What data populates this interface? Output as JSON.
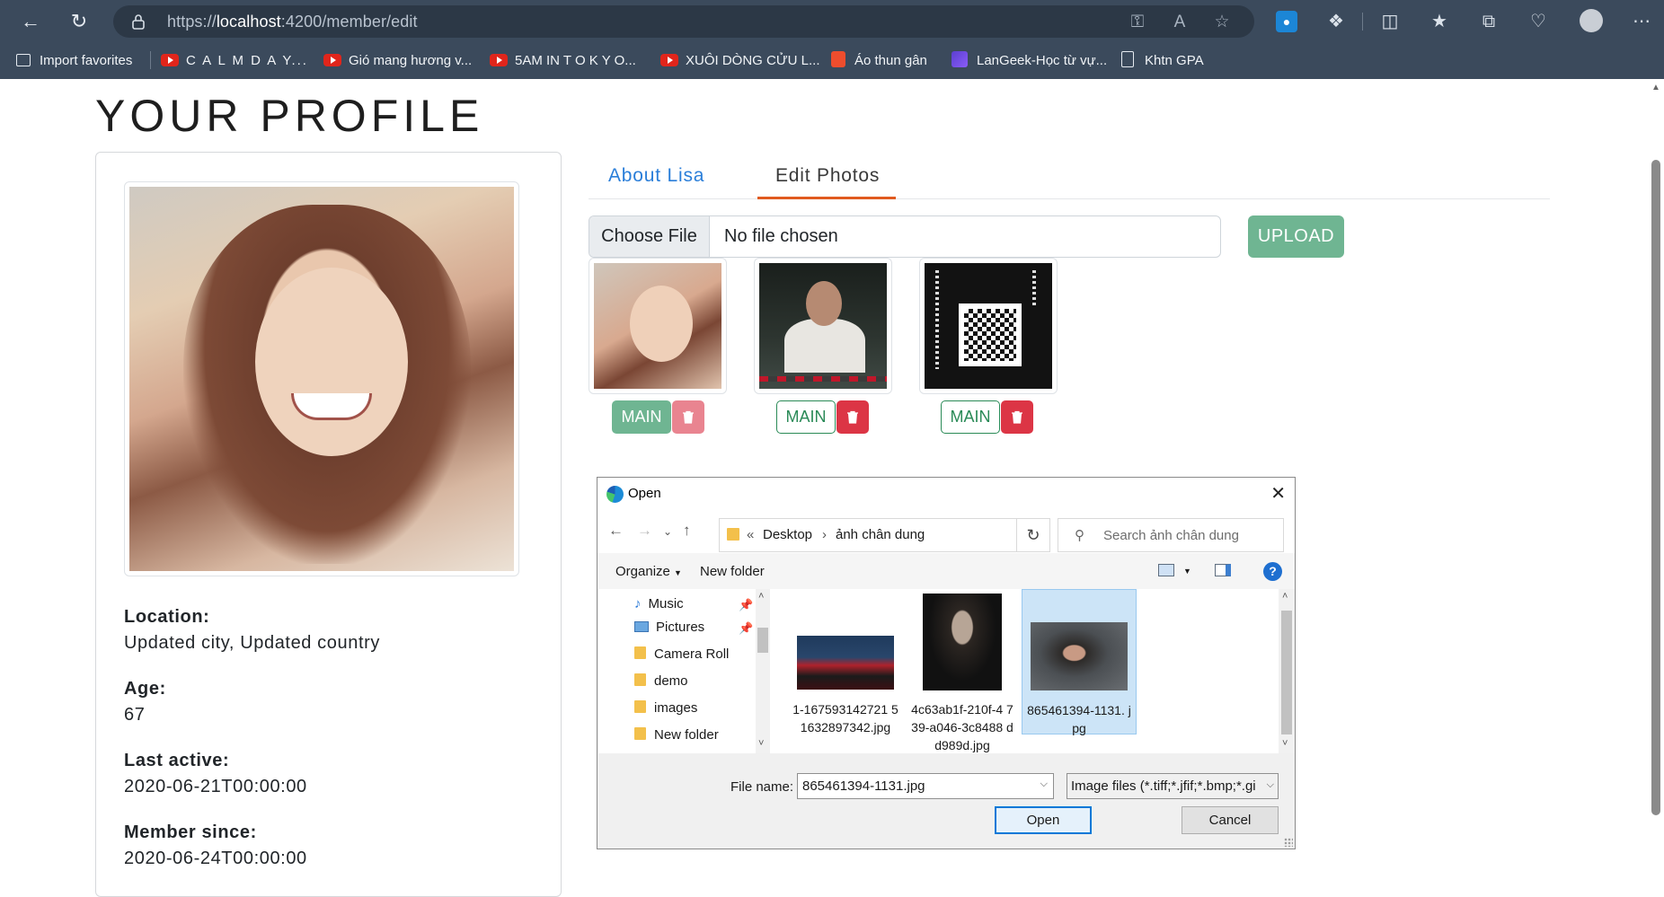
{
  "browser": {
    "url_prefix": "https://",
    "url_host": "localhost",
    "url_rest": ":4200/member/edit",
    "bookmarks": [
      {
        "label": "Import favorites",
        "icon": "import-icon"
      },
      {
        "label": "C A L M   D A Y...",
        "icon": "youtube-icon"
      },
      {
        "label": "Gió mang hương v...",
        "icon": "youtube-icon"
      },
      {
        "label": "5AM IN  T O K Y O...",
        "icon": "youtube-icon"
      },
      {
        "label": "XUÔI DÒNG CỬU L...",
        "icon": "youtube-icon"
      },
      {
        "label": "Áo thun gân",
        "icon": "shopee-icon"
      },
      {
        "label": "LanGeek-Học từ vự...",
        "icon": "langeek-icon"
      },
      {
        "label": "Khtn GPA",
        "icon": "document-icon"
      }
    ]
  },
  "page": {
    "title": "YOUR PROFILE"
  },
  "profile": {
    "location_label": "Location:",
    "location_value": "Updated city, Updated country",
    "age_label": "Age:",
    "age_value": "67",
    "last_active_label": "Last active:",
    "last_active_value": "2020-06-21T00:00:00",
    "member_since_label": "Member since:",
    "member_since_value": "2020-06-24T00:00:00"
  },
  "tabs": [
    {
      "label": "About Lisa",
      "active": false
    },
    {
      "label": "Edit Photos",
      "active": true
    }
  ],
  "upload": {
    "choose_label": "Choose File",
    "no_file_label": "No file chosen",
    "upload_label": "UPLOAD"
  },
  "photos": [
    {
      "main_label": "MAIN",
      "is_main": true
    },
    {
      "main_label": "MAIN",
      "is_main": false
    },
    {
      "main_label": "MAIN",
      "is_main": false
    }
  ],
  "dialog": {
    "title": "Open",
    "path_sep": "«",
    "path_1": "Desktop",
    "path_2": "ảnh chân dung",
    "search_placeholder": "Search ảnh chân dung",
    "organize_label": "Organize",
    "new_folder_label": "New folder",
    "tree": [
      {
        "label": "Music",
        "icon": "music-icon",
        "pinned": true
      },
      {
        "label": "Pictures",
        "icon": "pictures-icon",
        "pinned": true
      },
      {
        "label": "Camera Roll",
        "icon": "folder-icon",
        "pinned": false
      },
      {
        "label": "demo",
        "icon": "folder-icon",
        "pinned": false
      },
      {
        "label": "images",
        "icon": "folder-icon",
        "pinned": false
      },
      {
        "label": "New folder",
        "icon": "folder-icon",
        "pinned": false
      }
    ],
    "files": [
      {
        "name": "1-167593142721 51632897342.jpg",
        "selected": false
      },
      {
        "name": "4c63ab1f-210f-4 739-a046-3c8488 dd989d.jpg",
        "selected": false
      },
      {
        "name": "865461394-1131. jpg",
        "selected": true
      }
    ],
    "file_name_label": "File name:",
    "file_name_value": "865461394-1131.jpg",
    "filter_value": "Image files (*.tiff;*.jfif;*.bmp;*.gi",
    "open_label": "Open",
    "cancel_label": "Cancel"
  },
  "colors": {
    "chrome": "#3b4a5c",
    "tab_active_underline": "#e05a1f",
    "tab_link": "#2a7ed9",
    "success": "#6fb592",
    "danger": "#dc3545",
    "dialog_selection": "#cce4f7"
  }
}
